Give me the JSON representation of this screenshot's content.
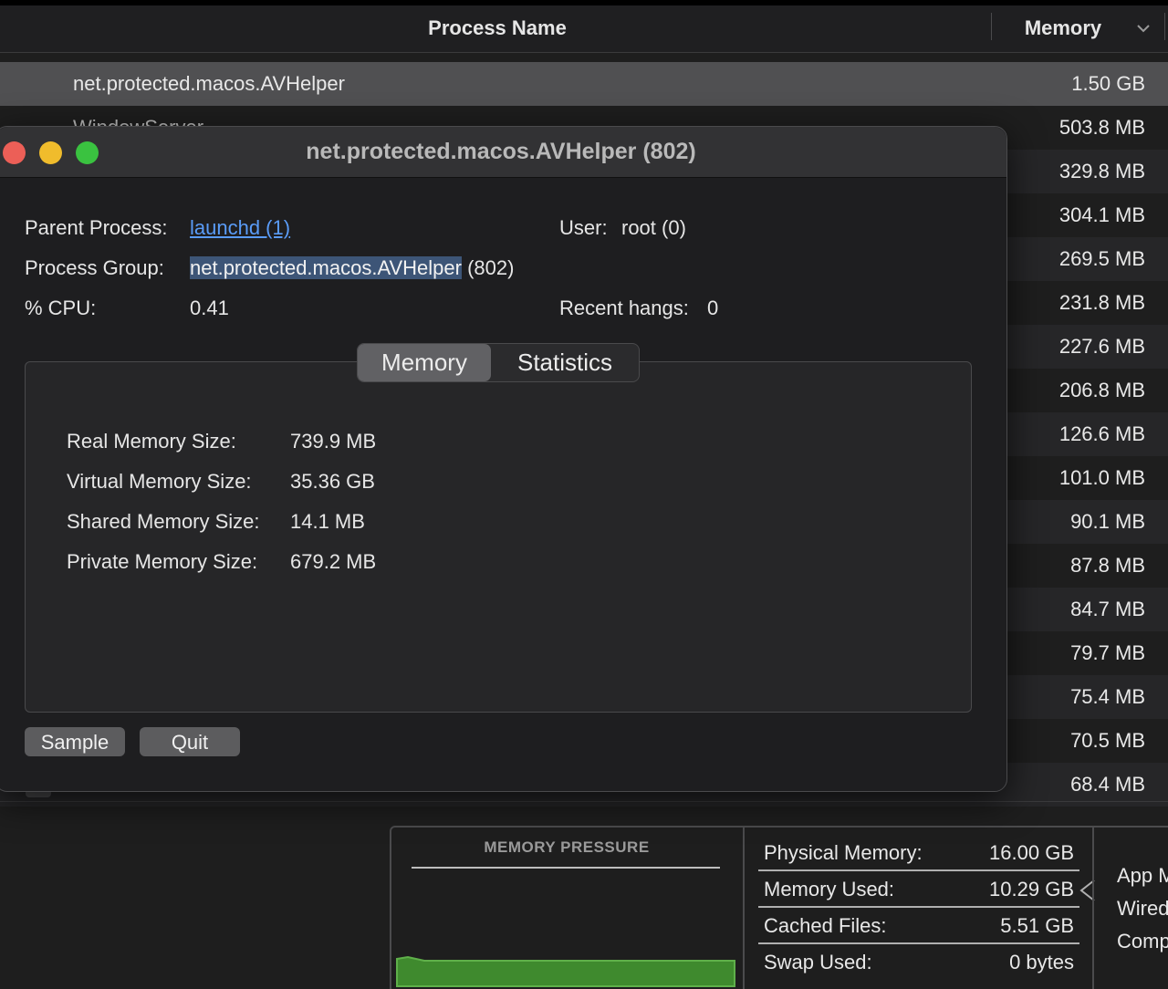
{
  "table": {
    "col_name": "Process Name",
    "col_memory": "Memory",
    "rows": [
      {
        "name": "net.protected.macos.AVHelper",
        "memory": "1.50 GB"
      },
      {
        "name": "WindowServer",
        "memory": "503.8 MB"
      },
      {
        "name": "",
        "memory": "329.8 MB"
      },
      {
        "name": "",
        "memory": "304.1 MB"
      },
      {
        "name": "",
        "memory": "269.5 MB"
      },
      {
        "name": "",
        "memory": "231.8 MB"
      },
      {
        "name": "",
        "memory": "227.6 MB"
      },
      {
        "name": "",
        "memory": "206.8 MB"
      },
      {
        "name": "",
        "memory": "126.6 MB"
      },
      {
        "name": "",
        "memory": "101.0 MB"
      },
      {
        "name": "",
        "memory": "90.1 MB"
      },
      {
        "name": "",
        "memory": "87.8 MB"
      },
      {
        "name": "",
        "memory": "84.7 MB"
      },
      {
        "name": "",
        "memory": "79.7 MB"
      },
      {
        "name": "",
        "memory": "75.4 MB"
      },
      {
        "name": "",
        "memory": "70.5 MB"
      },
      {
        "name": "",
        "memory": "68.4 MB"
      }
    ]
  },
  "inspector": {
    "title": "net.protected.macos.AVHelper (802)",
    "parent_label": "Parent Process:",
    "parent_value": "launchd (1)",
    "user_label": "User:",
    "user_value": "root (0)",
    "group_label": "Process Group:",
    "group_value": "net.protected.macos.AVHelper",
    "group_pid": "(802)",
    "cpu_label": "% CPU:",
    "cpu_value": "0.41",
    "hangs_label": "Recent hangs:",
    "hangs_value": "0",
    "tabs": [
      "Memory",
      "Statistics"
    ],
    "memory_stats": [
      {
        "label": "Real Memory Size:",
        "value": "739.9 MB"
      },
      {
        "label": "Virtual Memory Size:",
        "value": "35.36 GB"
      },
      {
        "label": "Shared Memory Size:",
        "value": "14.1 MB"
      },
      {
        "label": "Private Memory Size:",
        "value": "679.2 MB"
      }
    ],
    "sample_button": "Sample",
    "quit_button": "Quit"
  },
  "memory_panel": {
    "pressure_title": "MEMORY PRESSURE",
    "pressure_color": "#3f8a2e",
    "stats": [
      {
        "label": "Physical Memory:",
        "value": "16.00 GB"
      },
      {
        "label": "Memory Used:",
        "value": "10.29 GB"
      },
      {
        "label": "Cached Files:",
        "value": "5.51 GB"
      },
      {
        "label": "Swap Used:",
        "value": "0 bytes"
      }
    ],
    "legend": [
      "App M",
      "Wired",
      "Comp"
    ]
  }
}
